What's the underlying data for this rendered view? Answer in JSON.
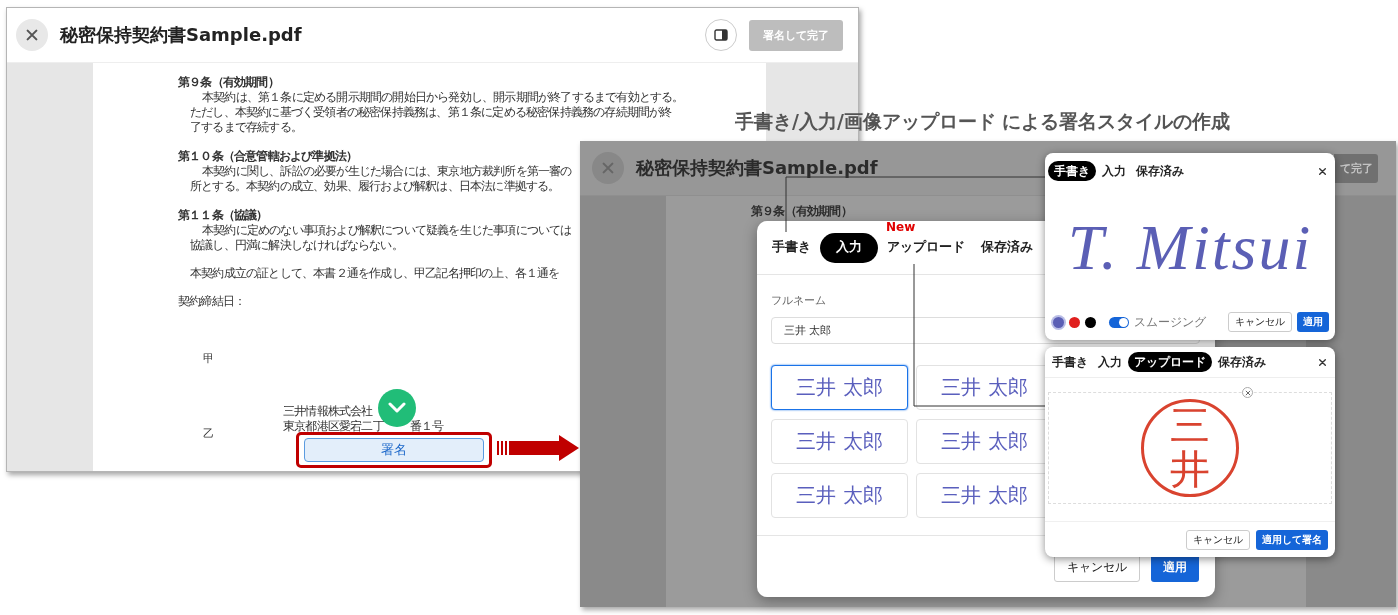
{
  "viewer": {
    "title": "秘密保持契約書Sample.pdf",
    "finish_button": {
      "label": "署名して完了",
      "disabled": true
    },
    "lines": [
      {
        "kind": "heading",
        "text": "第９条（有効期間）"
      },
      {
        "kind": "first",
        "text": "本契約は、第１条に定める開示期間の開始日から発効し、開示期間が終了するまで有効とする。"
      },
      {
        "kind": "cont",
        "text": "ただし、本契約に基づく受領者の秘密保持義務は、第１条に定める秘密保持義務の存続期間が終"
      },
      {
        "kind": "cont",
        "text": "了するまで存続する。"
      },
      {
        "kind": "heading",
        "text": "第１０条（合意管轄および準拠法）"
      },
      {
        "kind": "first",
        "text": "本契約に関し、訴訟の必要が生じた場合には、東京地方裁判所を第一審の"
      },
      {
        "kind": "cont",
        "text": "所とする。本契約の成立、効果、履行および解釈は、日本法に準拠する。"
      },
      {
        "kind": "heading",
        "text": "第１１条（協議）"
      },
      {
        "kind": "first",
        "text": "本契約に定めのない事項および解釈について疑義を生じた事項については"
      },
      {
        "kind": "cont",
        "text": "協議し、円満に解決しなければならない。"
      },
      {
        "kind": "para",
        "text": "本契約成立の証として、本書２通を作成し、甲乙記名押印の上、各１通を"
      },
      {
        "kind": "label",
        "text": "契約締結日："
      }
    ],
    "party_a": "甲",
    "party_b": "乙",
    "company": "三井情報株式会社",
    "address_parts": [
      "東京都港区愛宕二丁",
      "番１号"
    ],
    "sign_button": "署名",
    "sign_complete": true
  },
  "caption": "手書き/入力/画像アップロード による署名スタイルの作成",
  "dimmed_viewer": {
    "title": "秘密保持契約書Sample.pdf",
    "finish_button": {
      "label": "て完了",
      "disabled": true
    },
    "lines": [
      {
        "kind": "heading",
        "text": "第９条（有効期間）"
      }
    ]
  },
  "signature_dialog": {
    "tabs": [
      {
        "label": "手書き",
        "selected": false
      },
      {
        "label": "入力",
        "selected": true
      },
      {
        "label": "アップロード",
        "selected": false,
        "badge": "New"
      },
      {
        "label": "保存済み",
        "selected": false
      }
    ],
    "field_label": "フルネーム",
    "field_value": "三井 太郎",
    "styles": [
      {
        "text": "三井 太郎",
        "selected": true
      },
      {
        "text": "三井 太郎",
        "selected": false
      },
      {
        "text": "三井 太郎",
        "selected": false
      },
      {
        "text": "三井 太郎",
        "selected": false
      },
      {
        "text": "三井 太郎",
        "selected": false
      },
      {
        "text": "三井 太郎",
        "selected": false
      }
    ],
    "cancel": "キャンセル",
    "apply": "適用"
  },
  "draw_popup": {
    "tabs": [
      {
        "label": "手書き",
        "selected": true
      },
      {
        "label": "入力",
        "selected": false
      },
      {
        "label": "保存済み",
        "selected": false
      }
    ],
    "signature": "T. Mitsui",
    "colors": [
      {
        "color": "#5b5fb5",
        "selected": true
      },
      {
        "color": "#e0201e",
        "selected": false
      },
      {
        "color": "#000000",
        "selected": false
      }
    ],
    "smoothing": {
      "label": "スムージング",
      "on": true
    },
    "cancel": "キャンセル",
    "apply": "適用"
  },
  "upload_popup": {
    "tabs": [
      {
        "label": "手書き",
        "selected": false
      },
      {
        "label": "入力",
        "selected": false
      },
      {
        "label": "アップロード",
        "selected": true
      },
      {
        "label": "保存済み",
        "selected": false
      }
    ],
    "stamp": "三井",
    "cancel": "キャンセル",
    "apply": "適用して署名"
  }
}
